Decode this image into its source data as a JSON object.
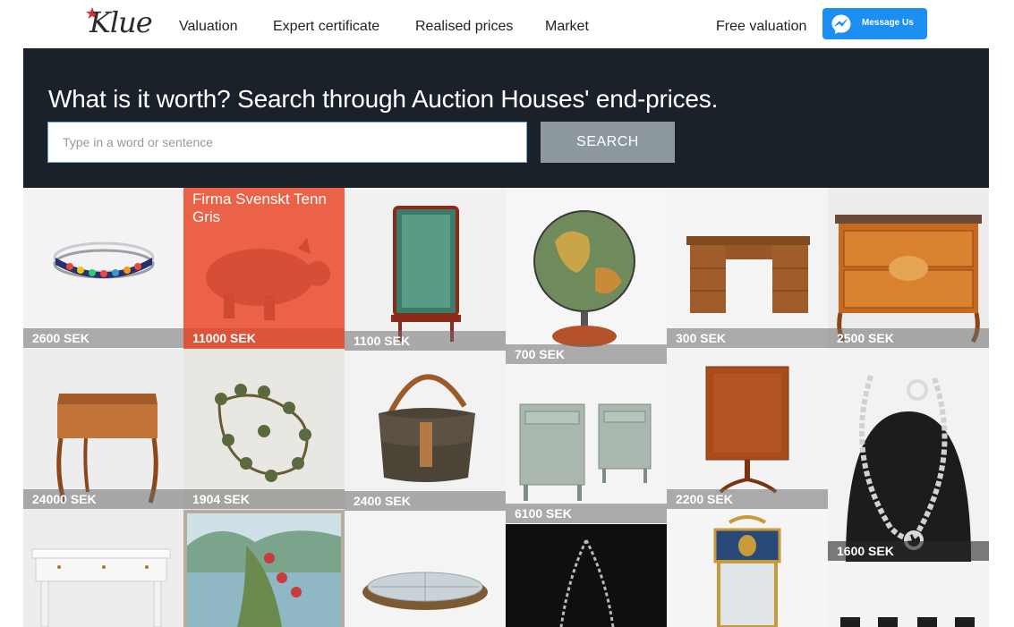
{
  "brand": {
    "logo_text": "Klue",
    "accent": "#d8333d"
  },
  "nav": {
    "links": [
      "Valuation",
      "Expert certificate",
      "Realised prices",
      "Market"
    ],
    "free_valuation": "Free valuation",
    "messenger_label": "Message Us",
    "messenger_color": "#1d8ef2"
  },
  "hero": {
    "title": "What is it worth?  Search through Auction Houses' end-prices.",
    "search_placeholder": "Type in a word or sentence",
    "search_value": "",
    "search_button": "SEARCH",
    "background": "#1b2129"
  },
  "gallery": {
    "items": [
      {
        "icon": "bangle-bracelet-icon",
        "price": "2600 SEK"
      },
      {
        "icon": "pewter-pig-icon",
        "title": "Firma Svenskt Tenn Gris",
        "price": "11000 SEK"
      },
      {
        "icon": "glass-vitrine-cabinet-icon",
        "price": "1100 SEK"
      },
      {
        "icon": "globe-lamp-icon",
        "price": "700 SEK"
      },
      {
        "icon": "desk-icon",
        "price": "300 SEK"
      },
      {
        "icon": "commode-icon",
        "price": "2500 SEK"
      },
      {
        "icon": "writing-desk-icon",
        "price": "24000 SEK"
      },
      {
        "icon": "candelabra-icon",
        "price": "1904 SEK"
      },
      {
        "icon": "handbag-icon",
        "price": "2400 SEK"
      },
      {
        "icon": "nightstands-icon",
        "price": "6100 SEK"
      },
      {
        "icon": "tilt-top-table-icon",
        "price": "2200 SEK"
      },
      {
        "icon": "silver-necklace-icon",
        "price": "1600 SEK"
      },
      {
        "icon": "white-desk-icon"
      },
      {
        "icon": "landscape-painting-icon"
      },
      {
        "icon": "glass-serving-dish-icon"
      },
      {
        "icon": "chain-necklace-icon"
      },
      {
        "icon": "gilt-mirror-icon"
      },
      {
        "icon": "chairs-icon"
      }
    ]
  }
}
